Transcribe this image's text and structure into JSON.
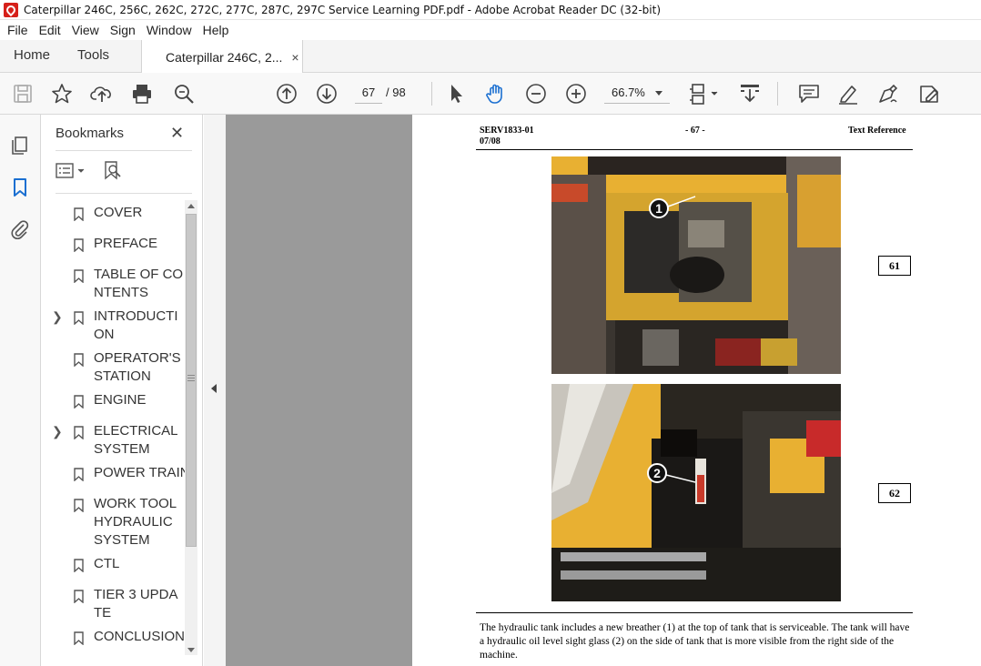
{
  "window": {
    "title": "Caterpillar 246C, 256C, 262C, 272C, 277C, 287C, 297C Service Learning PDF.pdf - Adobe Acrobat Reader DC (32-bit)"
  },
  "menu": [
    "File",
    "Edit",
    "View",
    "Sign",
    "Window",
    "Help"
  ],
  "tabs": {
    "home": "Home",
    "tools": "Tools",
    "document": "Caterpillar 246C, 2...",
    "close": "×"
  },
  "toolbar": {
    "current_page": "67",
    "total_pages": "/ 98",
    "zoom": "66.7%"
  },
  "bookmarks": {
    "title": "Bookmarks",
    "close": "✕",
    "items": [
      {
        "label": "COVER",
        "expandable": false
      },
      {
        "label": "PREFACE",
        "expandable": false
      },
      {
        "label": "TABLE OF CONTENTS",
        "expandable": false
      },
      {
        "label": "INTRODUCTION",
        "expandable": true
      },
      {
        "label": "OPERATOR'S STATION",
        "expandable": false
      },
      {
        "label": "ENGINE",
        "expandable": false
      },
      {
        "label": "ELECTRICAL SYSTEM",
        "expandable": true
      },
      {
        "label": "POWER TRAIN",
        "expandable": false
      },
      {
        "label": "WORK TOOL HYDRAULIC SYSTEM",
        "expandable": false
      },
      {
        "label": "CTL",
        "expandable": false
      },
      {
        "label": "TIER 3 UPDATE",
        "expandable": false
      },
      {
        "label": "CONCLUSION",
        "expandable": false
      }
    ]
  },
  "page": {
    "header_left_line1": "SERV1833-01",
    "header_left_line2": "07/08",
    "header_center": "- 67 -",
    "header_right": "Text Reference",
    "figures": [
      {
        "number": "61",
        "callout": "1"
      },
      {
        "number": "62",
        "callout": "2"
      }
    ],
    "body": "The hydraulic tank includes a new breather (1) at the top of tank that is serviceable.  The tank will have a hydraulic oil level sight glass (2) on the side of tank that is more visible from the right side of the machine."
  },
  "colors": {
    "accent_blue": "#1a6fd1",
    "viewer_bg": "#9a9a9a",
    "machine_yellow": "#e8b032"
  }
}
